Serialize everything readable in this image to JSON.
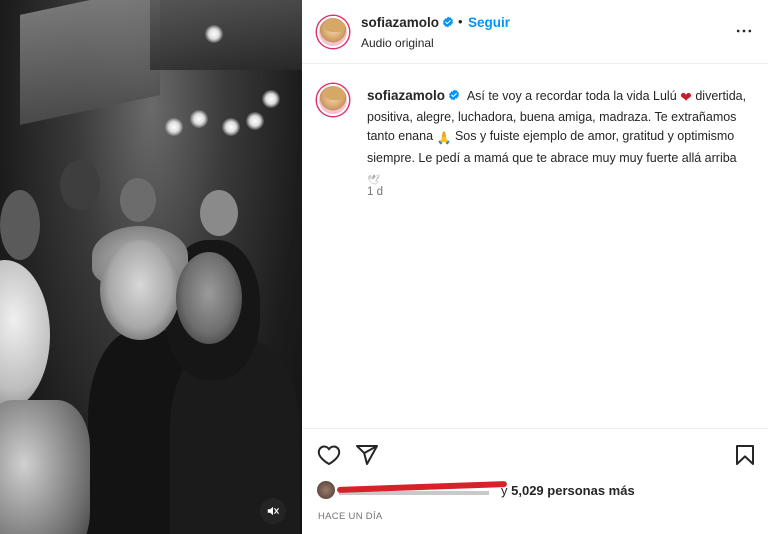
{
  "media": {
    "mute_icon": "speaker-muted-icon"
  },
  "header": {
    "username": "sofiazamolo",
    "separator": "•",
    "follow_label": "Seguir",
    "subtitle": "Audio original",
    "more_icon": "ellipsis-icon"
  },
  "caption": {
    "username": "sofiazamolo",
    "text_1": "Así te voy a recordar toda la vida Lulú",
    "emoji_heart": "❤",
    "text_2": "divertida, positiva, alegre, luchadora, buena amiga, madraza. Te extrañamos tanto enana",
    "emoji_pray": "🙏",
    "text_3": "Sos y fuiste ejemplo de amor, gratitud y optimismo siempre. Le pedí a mamá que te abrace muy muy fuerte allá arriba",
    "emoji_dove": "🕊",
    "time": "1 d"
  },
  "actions": {
    "like_icon": "heart-outline-icon",
    "share_icon": "paper-plane-icon",
    "save_icon": "bookmark-icon"
  },
  "likes": {
    "connector": "y",
    "count_text": "5,029 personas más"
  },
  "timestamp": "HACE UN DÍA",
  "colors": {
    "accent": "#0095f6",
    "text": "#262626",
    "muted": "#737373",
    "heart": "#c81e2c",
    "strike": "#d8222a"
  }
}
